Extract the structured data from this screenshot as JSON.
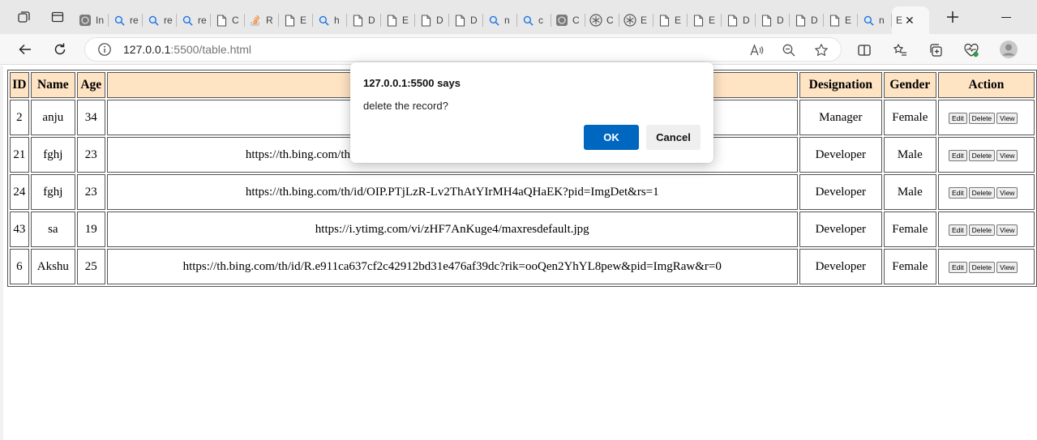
{
  "browser": {
    "tabs": [
      {
        "icon": "ai-logo-icon",
        "label": "In"
      },
      {
        "icon": "search-icon",
        "label": "re"
      },
      {
        "icon": "search-icon",
        "label": "re"
      },
      {
        "icon": "search-icon",
        "label": "re"
      },
      {
        "icon": "document-icon",
        "label": "C"
      },
      {
        "icon": "stackoverflow-icon",
        "label": "R"
      },
      {
        "icon": "document-icon",
        "label": "E"
      },
      {
        "icon": "search-icon",
        "label": "h"
      },
      {
        "icon": "document-icon",
        "label": "D"
      },
      {
        "icon": "document-icon",
        "label": "E"
      },
      {
        "icon": "document-icon",
        "label": "D"
      },
      {
        "icon": "document-icon",
        "label": "D"
      },
      {
        "icon": "search-icon",
        "label": "n"
      },
      {
        "icon": "search-icon",
        "label": "c"
      },
      {
        "icon": "ai-logo-icon",
        "label": "C"
      },
      {
        "icon": "openai-icon",
        "label": "C"
      },
      {
        "icon": "openai-icon",
        "label": "E"
      },
      {
        "icon": "document-icon",
        "label": "E"
      },
      {
        "icon": "document-icon",
        "label": "E"
      },
      {
        "icon": "document-icon",
        "label": "D"
      },
      {
        "icon": "document-icon",
        "label": "D"
      },
      {
        "icon": "document-icon",
        "label": "D"
      },
      {
        "icon": "document-icon",
        "label": "E"
      },
      {
        "icon": "search-icon",
        "label": "n"
      }
    ],
    "active_tab": {
      "label": "E"
    },
    "address": {
      "host": "127.0.0.1",
      "rest": ":5500/table.html"
    }
  },
  "table": {
    "headers": {
      "id": "ID",
      "name": "Name",
      "age": "Age",
      "image": "",
      "designation": "Designation",
      "gender": "Gender",
      "action": "Action"
    },
    "rows": [
      {
        "id": "2",
        "name": "anju",
        "age": "34",
        "image": "",
        "designation": "Manager",
        "gender": "Female"
      },
      {
        "id": "21",
        "name": "fghj",
        "age": "23",
        "image": "https://th.bing.com/th/id/OIP.PTjLzR-Lv2ThAtYIrMH4aQHaEK?pid=ImgDet&rs=1",
        "designation": "Developer",
        "gender": "Male"
      },
      {
        "id": "24",
        "name": "fghj",
        "age": "23",
        "image": "https://th.bing.com/th/id/OIP.PTjLzR-Lv2ThAtYIrMH4aQHaEK?pid=ImgDet&rs=1",
        "designation": "Developer",
        "gender": "Male"
      },
      {
        "id": "43",
        "name": "sa",
        "age": "19",
        "image": "https://i.ytimg.com/vi/zHF7AnKuge4/maxresdefault.jpg",
        "designation": "Developer",
        "gender": "Female"
      },
      {
        "id": "6",
        "name": "Akshu",
        "age": "25",
        "image": "https://th.bing.com/th/id/R.e911ca637cf2c42912bd31e476af39dc?rik=ooQen2YhYL8pew&pid=ImgRaw&r=0",
        "designation": "Developer",
        "gender": "Female"
      }
    ],
    "actions": {
      "edit": "Edit",
      "delete": "Delete",
      "view": "View"
    }
  },
  "dialog": {
    "title": "127.0.0.1:5500 says",
    "message": "delete the record?",
    "ok": "OK",
    "cancel": "Cancel"
  }
}
